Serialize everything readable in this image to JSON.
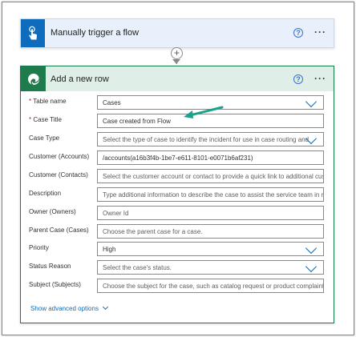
{
  "trigger": {
    "title": "Manually trigger a flow",
    "icon": "hand-tap-icon",
    "help": "?",
    "more": "···"
  },
  "connector": {
    "add": "+"
  },
  "action": {
    "title": "Add a new row",
    "icon": "dataverse-icon",
    "help": "?",
    "more": "···",
    "fields": [
      {
        "label": "Table name",
        "required": "*",
        "value": "Cases",
        "placeholder": "",
        "dropdown": true
      },
      {
        "label": "Case Title",
        "required": "*",
        "value": "Case created from Flow",
        "placeholder": "",
        "dropdown": false
      },
      {
        "label": "Case Type",
        "required": "",
        "value": "",
        "placeholder": "Select the type of case to identify the incident for use in case routing and",
        "dropdown": true
      },
      {
        "label": "Customer (Accounts)",
        "required": "",
        "value": "/accounts(a16b3f4b-1be7-e611-8101-e0071b6af231)",
        "placeholder": "",
        "dropdown": false
      },
      {
        "label": "Customer (Contacts)",
        "required": "",
        "value": "",
        "placeholder": "Select the customer account or contact to provide a quick link to additional cus",
        "dropdown": false
      },
      {
        "label": "Description",
        "required": "",
        "value": "",
        "placeholder": "Type additional information to describe the case to assist the service team in re",
        "dropdown": false
      },
      {
        "label": "Owner (Owners)",
        "required": "",
        "value": "",
        "placeholder": "Owner Id",
        "dropdown": false
      },
      {
        "label": "Parent Case (Cases)",
        "required": "",
        "value": "",
        "placeholder": "Choose the parent case for a case.",
        "dropdown": false
      },
      {
        "label": "Priority",
        "required": "",
        "value": "High",
        "placeholder": "",
        "dropdown": true
      },
      {
        "label": "Status Reason",
        "required": "",
        "value": "",
        "placeholder": "Select the case's status.",
        "dropdown": true
      },
      {
        "label": "Subject (Subjects)",
        "required": "",
        "value": "",
        "placeholder": "Choose the subject for the case, such as catalog request or product complaint,",
        "dropdown": false
      }
    ],
    "advanced_label": "Show advanced options"
  },
  "colors": {
    "trigger_accent": "#0f6cbd",
    "action_accent": "#1e7c4c",
    "action_header_bg": "#dfeee6",
    "annotation_arrow": "#1aa38a"
  }
}
